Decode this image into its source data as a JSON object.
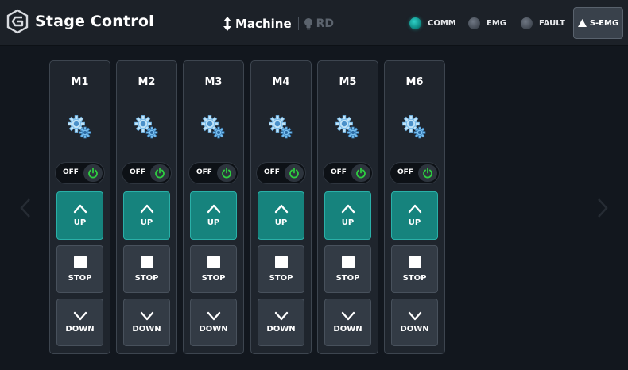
{
  "header": {
    "title": "Stage Control",
    "mode_label": "Machine",
    "rd_label": "RD",
    "status": [
      {
        "label": "COMM",
        "state": "on",
        "color": "#14b5ac"
      },
      {
        "label": "EMG",
        "state": "off",
        "color": "#5a616b"
      },
      {
        "label": "FAULT",
        "state": "off",
        "color": "#5a616b"
      }
    ],
    "semg_label": "S-EMG"
  },
  "icons": {
    "logo": "logo-icon",
    "mode": "up-down-arrow-icon",
    "rd": "lightbulb-icon",
    "semg": "warning-triangle-icon",
    "gear": "gears-icon",
    "power": "power-icon",
    "up": "chevron-up-icon",
    "stop": "square-stop-icon",
    "down": "chevron-down-icon",
    "nav_prev": "chevron-left-icon",
    "nav_next": "chevron-right-icon"
  },
  "motors": [
    {
      "name": "M1",
      "toggle_label": "OFF",
      "up_label": "UP",
      "stop_label": "STOP",
      "down_label": "DOWN"
    },
    {
      "name": "M2",
      "toggle_label": "OFF",
      "up_label": "UP",
      "stop_label": "STOP",
      "down_label": "DOWN"
    },
    {
      "name": "M3",
      "toggle_label": "OFF",
      "up_label": "UP",
      "stop_label": "STOP",
      "down_label": "DOWN"
    },
    {
      "name": "M4",
      "toggle_label": "OFF",
      "up_label": "UP",
      "stop_label": "STOP",
      "down_label": "DOWN"
    },
    {
      "name": "M5",
      "toggle_label": "OFF",
      "up_label": "UP",
      "stop_label": "STOP",
      "down_label": "DOWN"
    },
    {
      "name": "M6",
      "toggle_label": "OFF",
      "up_label": "UP",
      "stop_label": "STOP",
      "down_label": "DOWN"
    }
  ],
  "colors": {
    "accent": "#16837d",
    "power_on": "#2ecc40",
    "background": "#12171e",
    "panel": "#1f252d"
  }
}
